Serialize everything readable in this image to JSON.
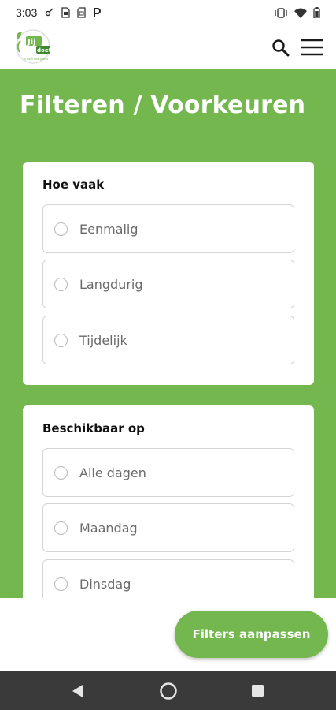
{
  "status_bar": {
    "time": "3:03",
    "left_icons": [
      "vpn-key-icon",
      "sim-card-icon",
      "sd-card-icon",
      "parking-icon"
    ],
    "right_icons": [
      "vibrate-icon",
      "wifi-icon",
      "battery-icon"
    ]
  },
  "app_bar": {
    "logo_text": "Jij doet",
    "icons": [
      "search-icon",
      "menu-icon"
    ]
  },
  "page": {
    "title": "Filteren / Voorkeuren"
  },
  "sections": [
    {
      "title": "Hoe vaak",
      "options": [
        "Eenmalig",
        "Langdurig",
        "Tijdelijk"
      ]
    },
    {
      "title": "Beschikbaar op",
      "options": [
        "Alle dagen",
        "Maandag",
        "Dinsdag"
      ]
    }
  ],
  "action": {
    "label": "Filters aanpassen"
  },
  "colors": {
    "brand_green": "#74b74f",
    "nav_bar": "#3a3a3a"
  },
  "nav_bar": {
    "icons": [
      "back-icon",
      "home-icon",
      "recents-icon"
    ]
  }
}
